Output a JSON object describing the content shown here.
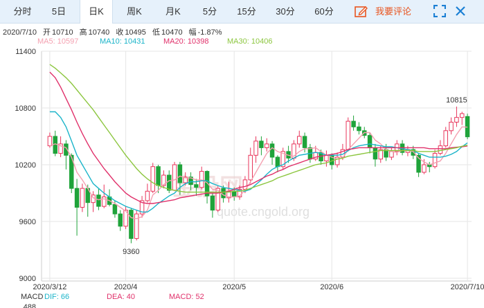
{
  "toolbar": {
    "tabs": [
      "分时",
      "5日",
      "日K",
      "周K",
      "月K",
      "5分",
      "15分",
      "30分",
      "60分"
    ],
    "active_index": 2,
    "comment_label": "我要评论",
    "icons": [
      "edit-icon",
      "fullscreen-icon",
      "close-icon"
    ]
  },
  "info": {
    "date": "2020/7/10",
    "open_label": "开",
    "open": "10710",
    "high_label": "高",
    "high": "10740",
    "close_label": "收",
    "close": "10495",
    "low_label": "低",
    "low": "10470",
    "change_label": "幅",
    "change": "-1.87%"
  },
  "legend": [
    {
      "text": "MA5: 10597",
      "color": "#f4a0b0"
    },
    {
      "text": "MA10: 10431",
      "color": "#1ab4c9"
    },
    {
      "text": "MA20: 10398",
      "color": "#e0306a"
    },
    {
      "text": "MA30: 10406",
      "color": "#8cc63f"
    }
  ],
  "macd_row": [
    {
      "text": "MACD",
      "color": "#333333"
    },
    {
      "text": "DIF: 66",
      "color": "#1ab4c9"
    },
    {
      "text": "DEA: 40",
      "color": "#e0306a"
    },
    {
      "text": "MACD: 52",
      "color": "#e0306a"
    }
  ],
  "macd_axis_label": "488",
  "watermark": {
    "main": "金投网",
    "sub": "quote.cngold.org"
  },
  "colors": {
    "up": "#e8345a",
    "down": "#1fa33a",
    "grid": "#e6e6e6"
  },
  "chart_data": {
    "type": "candlestick",
    "y_ticks": [
      11400,
      10800,
      10200,
      9600,
      9000
    ],
    "ylim": [
      9000,
      11400
    ],
    "x_tick_labels": [
      {
        "label": "2020/3/12",
        "index": 0
      },
      {
        "label": "2020/4",
        "index": 14
      },
      {
        "label": "2020/5",
        "index": 34
      },
      {
        "label": "2020/6",
        "index": 52
      },
      {
        "label": "2020/7/10",
        "index": 77
      }
    ],
    "annotations": [
      {
        "label": "9360",
        "index": 15,
        "value": 9360
      },
      {
        "label": "10815",
        "index": 75,
        "value": 10815
      }
    ],
    "candles": [
      [
        10400,
        10500,
        10540,
        10380
      ],
      [
        10500,
        10320,
        10560,
        10290
      ],
      [
        10320,
        10420,
        10500,
        10280
      ],
      [
        10420,
        10300,
        10460,
        10150
      ],
      [
        10300,
        9950,
        10320,
        9900
      ],
      [
        9950,
        9750,
        10050,
        9450
      ],
      [
        9750,
        9950,
        10000,
        9700
      ],
      [
        9950,
        9800,
        9990,
        9650
      ],
      [
        9800,
        9880,
        9920,
        9700
      ],
      [
        9880,
        9760,
        9950,
        9720
      ],
      [
        9760,
        9860,
        9990,
        9740
      ],
      [
        9860,
        9780,
        9940,
        9760
      ],
      [
        9780,
        9680,
        9820,
        9640
      ],
      [
        9680,
        9550,
        9720,
        9500
      ],
      [
        9550,
        9720,
        9760,
        9520
      ],
      [
        9720,
        9420,
        9740,
        9370
      ],
      [
        9420,
        9680,
        9720,
        9400
      ],
      [
        9680,
        9820,
        9870,
        9640
      ],
      [
        9820,
        9920,
        10000,
        9800
      ],
      [
        9920,
        10180,
        10220,
        9900
      ],
      [
        10180,
        9980,
        10200,
        9900
      ],
      [
        9980,
        10090,
        10140,
        9950
      ],
      [
        10090,
        9930,
        10140,
        9900
      ],
      [
        9930,
        10200,
        10230,
        9920
      ],
      [
        10200,
        10010,
        10230,
        9880
      ],
      [
        10010,
        10070,
        10120,
        9980
      ],
      [
        10070,
        9990,
        10120,
        9930
      ],
      [
        9990,
        9960,
        10050,
        9870
      ],
      [
        9960,
        10130,
        10180,
        9940
      ],
      [
        10130,
        9870,
        10140,
        9790
      ],
      [
        9870,
        9720,
        9900,
        9640
      ],
      [
        9720,
        9950,
        9980,
        9700
      ],
      [
        9950,
        9850,
        9980,
        9800
      ],
      [
        9850,
        9920,
        10020,
        9800
      ],
      [
        9920,
        9860,
        9960,
        9820
      ],
      [
        9860,
        9940,
        9980,
        9830
      ],
      [
        9940,
        10040,
        10080,
        9900
      ],
      [
        10040,
        10300,
        10380,
        10000
      ],
      [
        10300,
        10450,
        10500,
        10220
      ],
      [
        10450,
        10380,
        10500,
        10300
      ],
      [
        10380,
        10420,
        10480,
        10340
      ],
      [
        10420,
        10280,
        10450,
        10200
      ],
      [
        10280,
        10180,
        10300,
        10120
      ],
      [
        10180,
        10340,
        10380,
        10150
      ],
      [
        10340,
        10270,
        10400,
        10220
      ],
      [
        10270,
        10420,
        10460,
        10240
      ],
      [
        10420,
        10500,
        10560,
        10380
      ],
      [
        10500,
        10380,
        10540,
        10330
      ],
      [
        10380,
        10260,
        10420,
        10220
      ],
      [
        10260,
        10330,
        10400,
        10240
      ],
      [
        10330,
        10240,
        10360,
        10200
      ],
      [
        10240,
        10300,
        10350,
        10180
      ],
      [
        10300,
        10200,
        10320,
        10150
      ],
      [
        10200,
        10280,
        10330,
        10170
      ],
      [
        10280,
        10360,
        10420,
        10250
      ],
      [
        10360,
        10660,
        10700,
        10340
      ],
      [
        10660,
        10600,
        10720,
        10560
      ],
      [
        10600,
        10560,
        10650,
        10520
      ],
      [
        10560,
        10510,
        10600,
        10480
      ],
      [
        10510,
        10380,
        10540,
        10320
      ],
      [
        10380,
        10260,
        10420,
        10180
      ],
      [
        10260,
        10360,
        10400,
        10220
      ],
      [
        10360,
        10280,
        10420,
        10240
      ],
      [
        10280,
        10340,
        10380,
        10250
      ],
      [
        10340,
        10420,
        10460,
        10300
      ],
      [
        10420,
        10330,
        10460,
        10300
      ],
      [
        10330,
        10360,
        10400,
        10290
      ],
      [
        10360,
        10300,
        10400,
        10260
      ],
      [
        10300,
        10120,
        10320,
        10070
      ],
      [
        10120,
        10200,
        10260,
        10100
      ],
      [
        10200,
        10180,
        10230,
        10120
      ],
      [
        10180,
        10320,
        10360,
        10160
      ],
      [
        10320,
        10400,
        10460,
        10300
      ],
      [
        10400,
        10560,
        10600,
        10380
      ],
      [
        10560,
        10650,
        10700,
        10520
      ],
      [
        10650,
        10700,
        10815,
        10600
      ],
      [
        10700,
        10740,
        10760,
        10620
      ],
      [
        10710,
        10495,
        10740,
        10470
      ]
    ],
    "ma5": [
      10400,
      10420,
      10400,
      10380,
      10280,
      10120,
      10040,
      9950,
      9850,
      9830,
      9840,
      9820,
      9790,
      9750,
      9710,
      9640,
      9630,
      9650,
      9720,
      9880,
      9930,
      9990,
      10030,
      10040,
      10080,
      10060,
      10060,
      10040,
      10040,
      10010,
      9940,
      9930,
      9880,
      9860,
      9860,
      9870,
      9930,
      10020,
      10120,
      10220,
      10320,
      10380,
      10340,
      10320,
      10300,
      10290,
      10340,
      10370,
      10370,
      10380,
      10340,
      10300,
      10280,
      10260,
      10270,
      10360,
      10420,
      10480,
      10540,
      10540,
      10460,
      10420,
      10360,
      10340,
      10330,
      10350,
      10350,
      10340,
      10270,
      10230,
      10200,
      10220,
      10240,
      10320,
      10420,
      10520,
      10600,
      10597
    ],
    "ma10": [
      10760,
      10760,
      10700,
      10600,
      10450,
      10300,
      10200,
      10100,
      10000,
      9950,
      9900,
      9860,
      9820,
      9790,
      9760,
      9740,
      9720,
      9700,
      9700,
      9740,
      9790,
      9830,
      9870,
      9900,
      9960,
      10000,
      10020,
      10020,
      10030,
      10030,
      10000,
      9980,
      9960,
      9950,
      9940,
      9930,
      9920,
      9940,
      9990,
      10040,
      10100,
      10150,
      10180,
      10200,
      10240,
      10270,
      10300,
      10310,
      10320,
      10330,
      10320,
      10300,
      10300,
      10300,
      10310,
      10350,
      10380,
      10400,
      10410,
      10420,
      10410,
      10400,
      10390,
      10390,
      10380,
      10370,
      10360,
      10350,
      10320,
      10300,
      10280,
      10280,
      10280,
      10290,
      10310,
      10340,
      10390,
      10431
    ],
    "ma20": [
      11180,
      11120,
      11020,
      10900,
      10780,
      10650,
      10530,
      10420,
      10320,
      10240,
      10160,
      10090,
      10020,
      9960,
      9900,
      9860,
      9830,
      9800,
      9790,
      9790,
      9800,
      9810,
      9820,
      9830,
      9850,
      9860,
      9870,
      9880,
      9890,
      9900,
      9900,
      9900,
      9910,
      9920,
      9940,
      9960,
      9970,
      9990,
      10020,
      10050,
      10080,
      10100,
      10130,
      10150,
      10180,
      10200,
      10220,
      10240,
      10260,
      10280,
      10290,
      10300,
      10310,
      10320,
      10340,
      10360,
      10370,
      10380,
      10380,
      10380,
      10380,
      10380,
      10380,
      10380,
      10380,
      10380,
      10380,
      10380,
      10380,
      10380,
      10370,
      10370,
      10370,
      10370,
      10380,
      10385,
      10390,
      10398
    ],
    "ma30": [
      11260,
      11220,
      11170,
      11120,
      11060,
      10990,
      10920,
      10850,
      10780,
      10700,
      10620,
      10540,
      10460,
      10380,
      10300,
      10230,
      10160,
      10100,
      10050,
      10010,
      9980,
      9960,
      9940,
      9930,
      9920,
      9910,
      9910,
      9910,
      9910,
      9910,
      9910,
      9910,
      9910,
      9910,
      9920,
      9920,
      9930,
      9950,
      9970,
      9990,
      10010,
      10030,
      10060,
      10080,
      10100,
      10120,
      10140,
      10160,
      10180,
      10200,
      10210,
      10220,
      10240,
      10260,
      10270,
      10290,
      10300,
      10310,
      10320,
      10330,
      10340,
      10350,
      10350,
      10350,
      10350,
      10350,
      10350,
      10350,
      10340,
      10340,
      10340,
      10340,
      10350,
      10360,
      10370,
      10380,
      10395,
      10406
    ]
  }
}
